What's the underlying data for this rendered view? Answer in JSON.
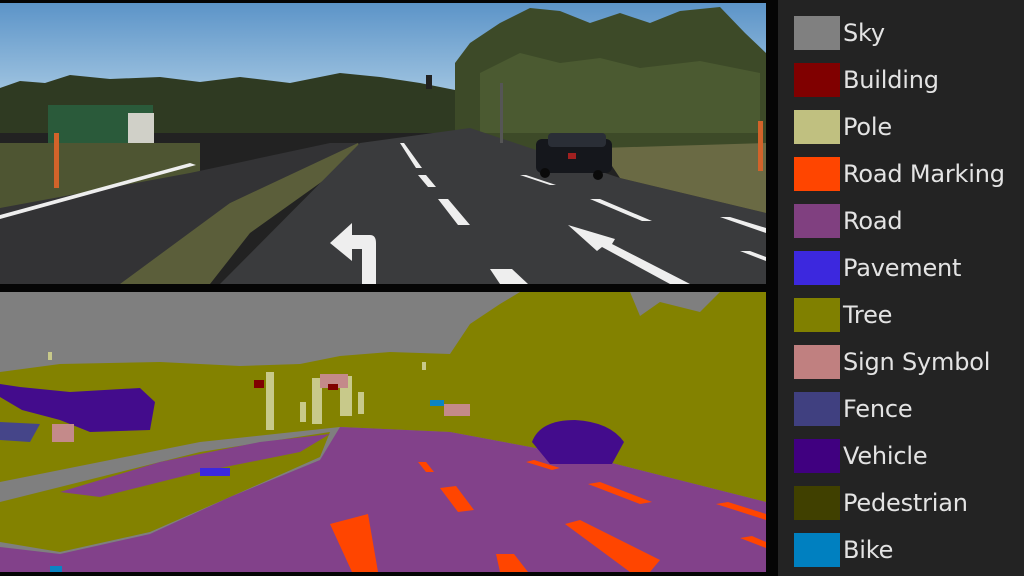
{
  "top_panel": {
    "description": "Camera frame: suburban road with turn arrows, dark station wagon, trees"
  },
  "bottom_panel": {
    "description": "Semantic segmentation output of the same frame"
  },
  "legend": {
    "items": [
      {
        "label": "Sky",
        "color": "#808080"
      },
      {
        "label": "Building",
        "color": "#800000"
      },
      {
        "label": "Pole",
        "color": "#c0c080"
      },
      {
        "label": "Road Marking",
        "color": "#ff4500"
      },
      {
        "label": "Road",
        "color": "#804080"
      },
      {
        "label": "Pavement",
        "color": "#3c28de"
      },
      {
        "label": "Tree",
        "color": "#808000"
      },
      {
        "label": "Sign Symbol",
        "color": "#c08080"
      },
      {
        "label": "Fence",
        "color": "#404080"
      },
      {
        "label": "Vehicle",
        "color": "#400080"
      },
      {
        "label": "Pedestrian",
        "color": "#404000"
      },
      {
        "label": "Bike",
        "color": "#0080c0"
      }
    ]
  }
}
